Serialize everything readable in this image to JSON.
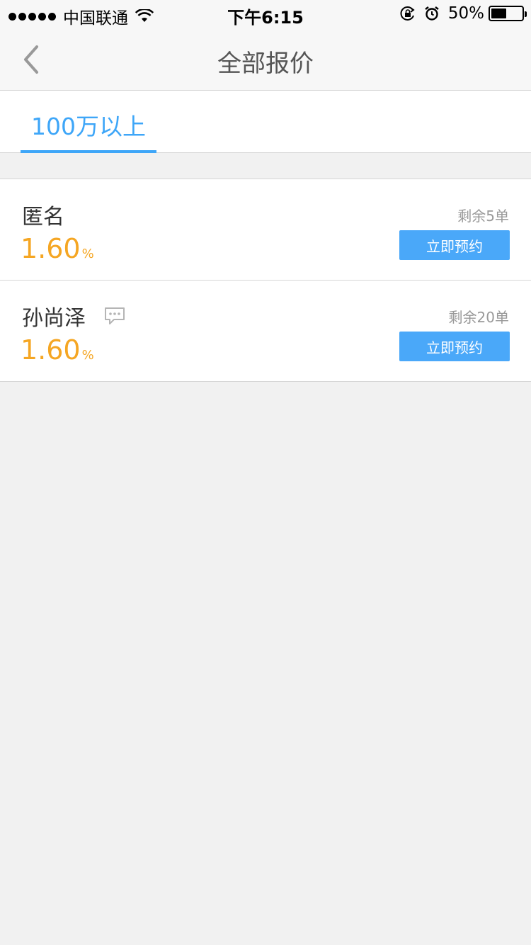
{
  "status_bar": {
    "carrier": "中国联通",
    "time": "下午6:15",
    "battery_percent": "50%",
    "battery_level": 0.5
  },
  "nav": {
    "title": "全部报价"
  },
  "tabs": [
    {
      "label": "100万以上",
      "active": true
    }
  ],
  "quotes": [
    {
      "name": "匿名",
      "rate": "1.60",
      "rate_unit": "%",
      "remaining": "剩余5单",
      "button": "立即预约",
      "has_message_icon": false
    },
    {
      "name": "孙尚泽",
      "rate": "1.60",
      "rate_unit": "%",
      "remaining": "剩余20单",
      "button": "立即预约",
      "has_message_icon": true
    }
  ],
  "colors": {
    "accent": "#3ea6f8",
    "rate": "#f5a623",
    "button": "#4aa8f9"
  }
}
